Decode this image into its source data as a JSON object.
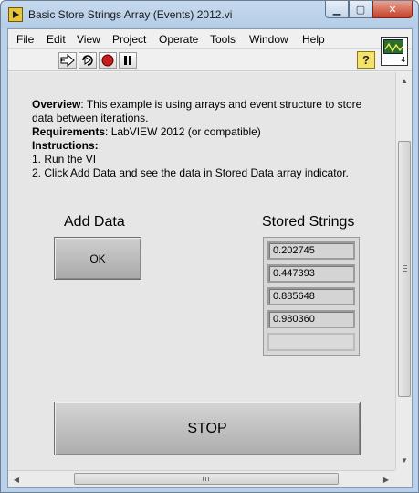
{
  "window": {
    "title": "Basic Store Strings Array (Events) 2012.vi",
    "minimize": "▁",
    "maximize": "▢",
    "close": "✕"
  },
  "menu": [
    "File",
    "Edit",
    "View",
    "Project",
    "Operate",
    "Tools",
    "Window",
    "Help"
  ],
  "toolbar": {
    "help": "?",
    "vi_icon_connector": "4"
  },
  "panel": {
    "overview_label": "Overview",
    "overview_text": ": This example is using  arrays and event structure to store data between iterations.",
    "requirements_label": "Requirements",
    "requirements_text": ": LabVIEW 2012 (or compatible)",
    "instructions_label": "Instructions",
    "step1": "1. Run the VI",
    "step2": "2. Click Add Data and see the data in  Stored Data array indicator.",
    "add_data_label": "Add Data",
    "ok_button": "OK",
    "stored_strings_label": "Stored Strings",
    "stored_strings": [
      "0.202745",
      "0.447393",
      "0.885648",
      "0.980360",
      ""
    ],
    "stop_button": "STOP"
  }
}
